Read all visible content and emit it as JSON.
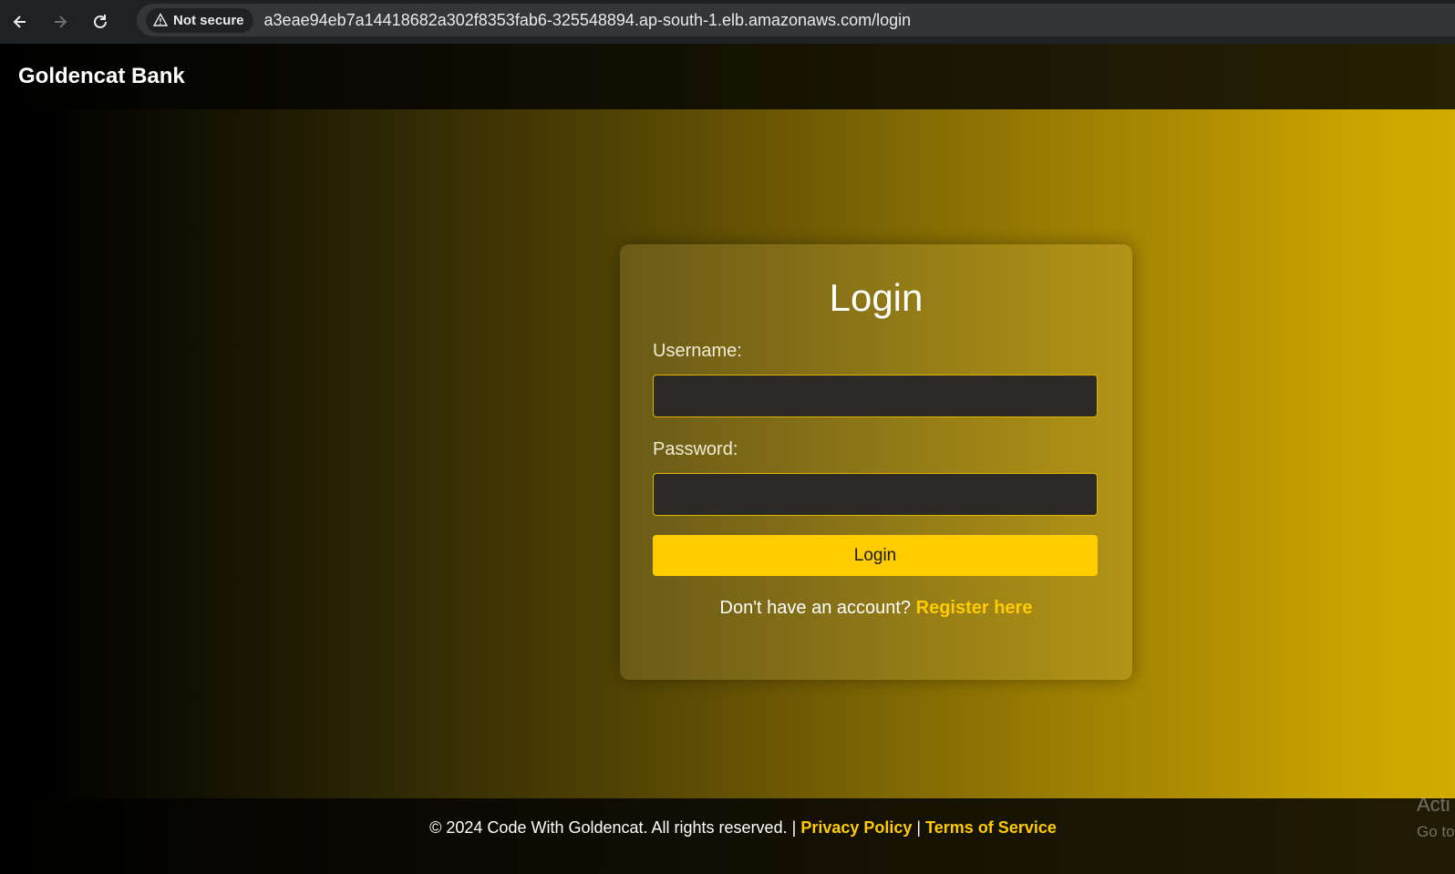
{
  "browser": {
    "security_label": "Not secure",
    "url": "a3eae94eb7a14418682a302f8353fab6-325548894.ap-south-1.elb.amazonaws.com/login"
  },
  "header": {
    "brand": "Goldencat Bank"
  },
  "login": {
    "title": "Login",
    "username_label": "Username:",
    "username_value": "",
    "password_label": "Password:",
    "password_value": "",
    "submit_label": "Login",
    "register_prompt": "Don't have an account?",
    "register_link": "Register here"
  },
  "footer": {
    "copyright": "© 2024 Code With Goldencat. All rights reserved.",
    "separator": "|",
    "privacy_link": "Privacy Policy",
    "terms_link": "Terms of Service"
  },
  "watermark": {
    "line1": "Acti",
    "line2": "Go to"
  },
  "colors": {
    "accent": "#ffcc00",
    "chrome_bg": "#202124"
  }
}
